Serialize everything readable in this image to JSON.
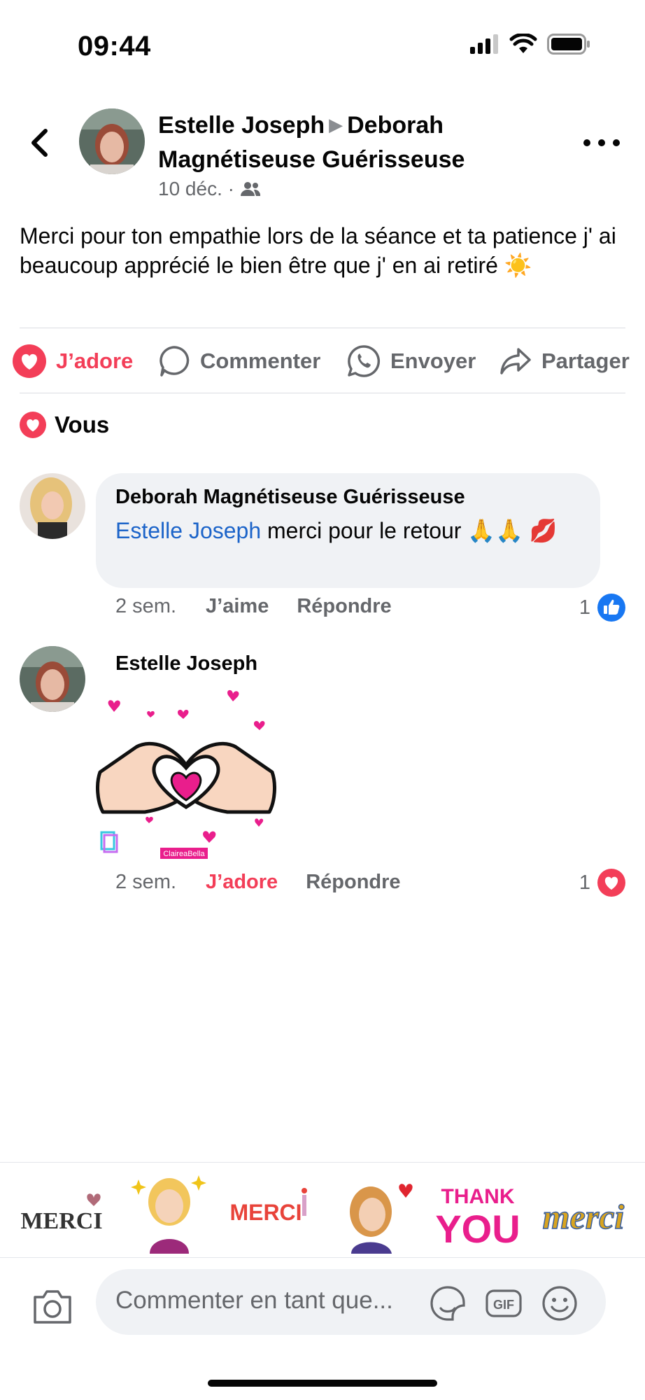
{
  "status_bar": {
    "time": "09:44"
  },
  "post": {
    "author": "Estelle Joseph",
    "recipient": "Deborah Magnétiseuse Guérisseuse",
    "date": "10 déc. ·",
    "text": "Merci pour ton empathie lors de la séance et ta patience j' ai beaucoup apprécié le bien être que j' en ai retiré ☀️"
  },
  "actions": {
    "love": "J’adore",
    "comment": "Commenter",
    "send": "Envoyer",
    "share": "Partager"
  },
  "reactions_summary": "Vous",
  "comments": [
    {
      "author": "Deborah Magnétiseuse Guérisseuse",
      "mention": "Estelle Joseph",
      "text": " merci pour le retour 🙏🙏 💋",
      "time": "2 sem.",
      "like_label": "J’aime",
      "reply_label": "Répondre",
      "reaction_count": "1"
    },
    {
      "author": "Estelle Joseph",
      "sticker_label": "ClaireaBella",
      "time": "2 sem.",
      "like_label": "J’adore",
      "reply_label": "Répondre",
      "reaction_count": "1"
    }
  ],
  "suggestions": [
    "MERCI",
    "MERCI",
    "THANK",
    "YOU",
    "merci"
  ],
  "composer": {
    "placeholder": "Commenter en tant que..."
  },
  "colors": {
    "love": "#f33e58",
    "like": "#1877f2",
    "mention": "#1c64c9",
    "muted": "#65676b"
  }
}
